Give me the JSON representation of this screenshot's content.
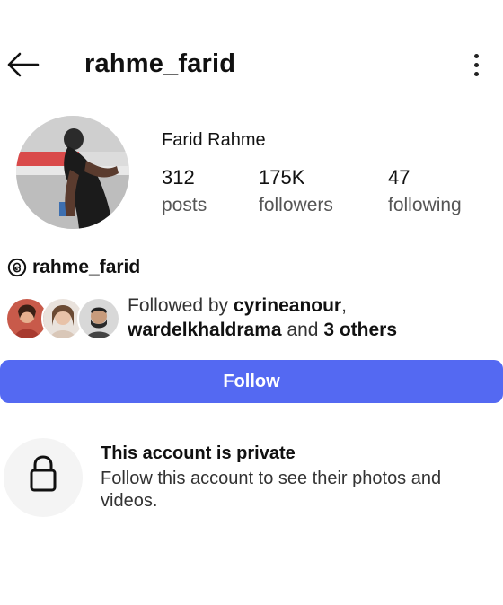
{
  "header": {
    "username": "rahme_farid",
    "back_icon": "arrow-left-icon",
    "menu_icon": "more-vertical-icon"
  },
  "profile": {
    "full_name": "Farid Rahme",
    "stats": [
      {
        "value": "312",
        "label": "posts"
      },
      {
        "value": "175K",
        "label": "followers"
      },
      {
        "value": "47",
        "label": "following"
      }
    ],
    "threads_handle": "rahme_farid",
    "threads_icon": "threads-icon"
  },
  "followed_by": {
    "prefix": "Followed by ",
    "user1": "cyrineanour",
    "separator": ",",
    "user2": "wardelkhaldrama",
    "middle": " and ",
    "others": "3 others"
  },
  "actions": {
    "follow_label": "Follow",
    "button_color": "#5469f2"
  },
  "privacy": {
    "title": "This account is private",
    "description": "Follow this account to see their photos and videos.",
    "icon": "lock-icon"
  }
}
